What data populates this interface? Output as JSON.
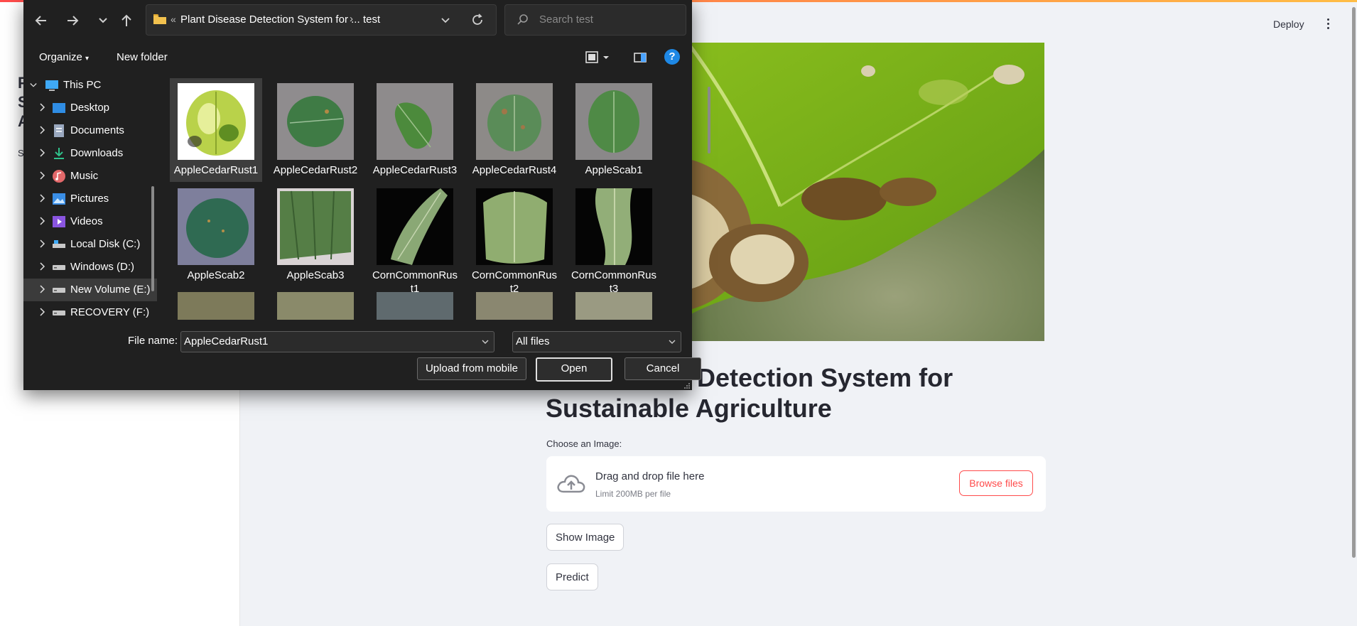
{
  "app": {
    "deploy_label": "Deploy",
    "sidebar_fragments": [
      "P",
      "S",
      "A"
    ],
    "sidebar_small": "S",
    "title_line1": "Detection System for",
    "title_line2": "Sustainable Agriculture",
    "choose_label": "Choose an Image:",
    "dropzone": {
      "main": "Drag and drop file here",
      "sub": "Limit 200MB per file",
      "browse_label": "Browse files"
    },
    "show_image_label": "Show Image",
    "predict_label": "Predict",
    "accent_color": "#ff4b4b"
  },
  "dialog": {
    "address": {
      "overflow": "«",
      "crumb1": "Plant Disease Detection System for ...",
      "crumb2": "test"
    },
    "search_placeholder": "Search test",
    "toolbar": {
      "organize": "Organize",
      "new_folder": "New folder",
      "help": "?"
    },
    "nav": [
      {
        "label": "This PC",
        "icon": "pc-icon",
        "expanded": true
      },
      {
        "label": "Desktop",
        "icon": "desktop-icon"
      },
      {
        "label": "Documents",
        "icon": "documents-icon"
      },
      {
        "label": "Downloads",
        "icon": "downloads-icon"
      },
      {
        "label": "Music",
        "icon": "music-icon"
      },
      {
        "label": "Pictures",
        "icon": "pictures-icon"
      },
      {
        "label": "Videos",
        "icon": "videos-icon"
      },
      {
        "label": "Local Disk (C:)",
        "icon": "disk-icon"
      },
      {
        "label": "Windows (D:)",
        "icon": "drive-icon"
      },
      {
        "label": "New Volume (E:)",
        "icon": "drive-icon",
        "selected": true
      },
      {
        "label": "RECOVERY (F:)",
        "icon": "drive-icon"
      }
    ],
    "files": [
      {
        "name": "AppleCedarRust1",
        "selected": true
      },
      {
        "name": "AppleCedarRust2"
      },
      {
        "name": "AppleCedarRust3"
      },
      {
        "name": "AppleCedarRust4"
      },
      {
        "name": "AppleScab1"
      },
      {
        "name": "AppleScab2"
      },
      {
        "name": "AppleScab3"
      },
      {
        "name": "CornCommonRus\nt1"
      },
      {
        "name": "CornCommonRus\nt2"
      },
      {
        "name": "CornCommonRus\nt3"
      }
    ],
    "file_name_label": "File name:",
    "file_name_value": "AppleCedarRust1",
    "filter_value": "All files",
    "buttons": {
      "upload": "Upload from mobile",
      "open": "Open",
      "cancel": "Cancel"
    }
  }
}
